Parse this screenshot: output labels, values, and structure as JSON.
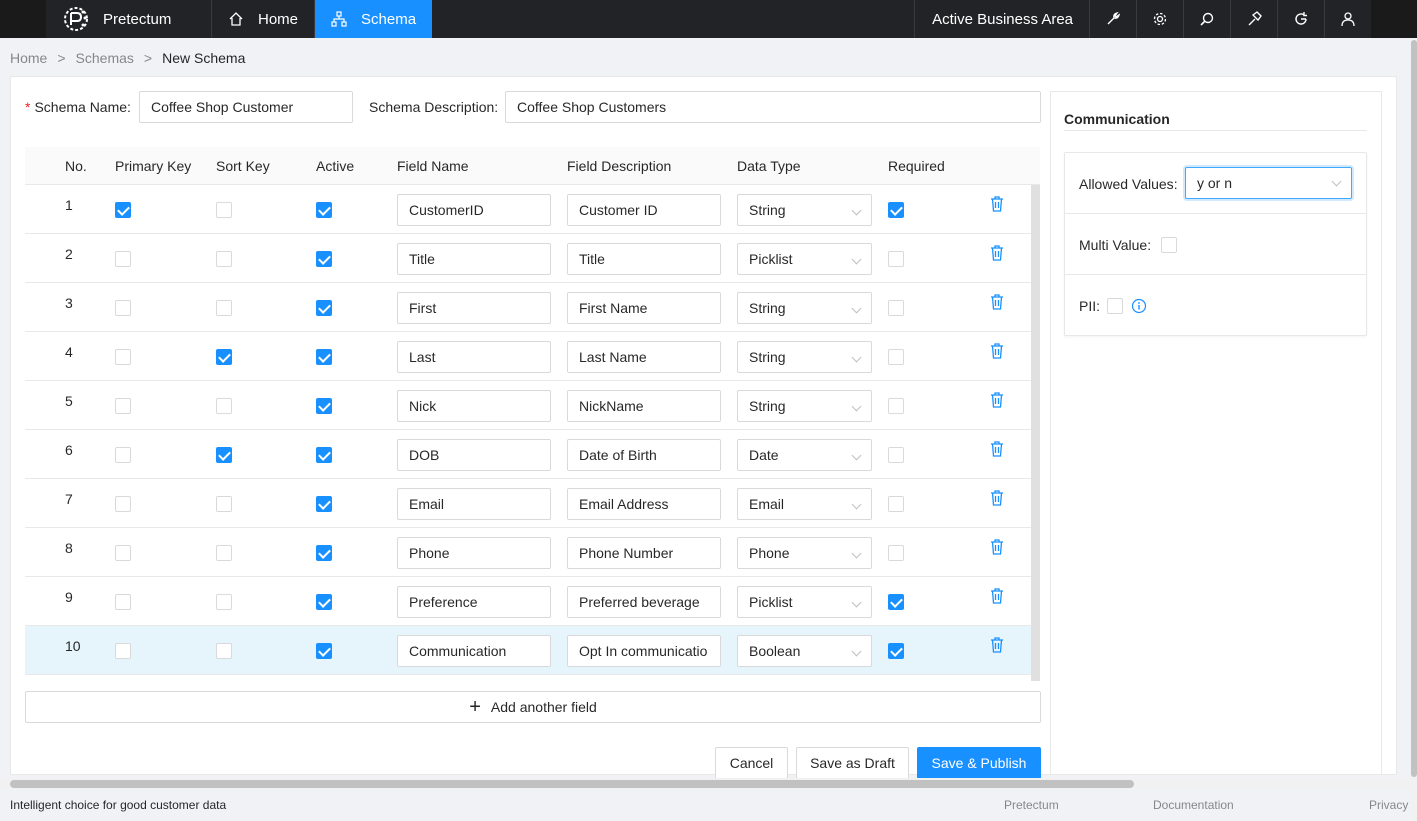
{
  "app": {
    "brand": "Pretectum"
  },
  "nav": {
    "items": [
      {
        "label": "Home",
        "icon": "home-icon"
      },
      {
        "label": "Schema",
        "icon": "schema-icon"
      }
    ],
    "area_label": "Active Business Area",
    "tool_icons": [
      "wrench-icon",
      "gear-icon",
      "search-icon",
      "hammer-icon",
      "refresh-icon",
      "user-icon"
    ]
  },
  "breadcrumb": {
    "home": "Home",
    "schemas": "Schemas",
    "current": "New Schema",
    "separator": ">"
  },
  "form": {
    "schema_name_label": "Schema Name",
    "schema_name_value": "Coffee Shop Customer",
    "schema_description_label": "Schema Description",
    "schema_description_value": "Coffee Shop Customers",
    "required_mark": "*",
    "colon": ":"
  },
  "table": {
    "columns": [
      "No.",
      "Primary Key",
      "Sort Key",
      "Active",
      "Field Name",
      "Field Description",
      "Data Type",
      "Required"
    ],
    "rows": [
      {
        "no": "1",
        "primary_key": true,
        "sort_key": false,
        "active": true,
        "field_name": "CustomerID",
        "field_description": "Customer ID",
        "data_type": "String",
        "required": true
      },
      {
        "no": "2",
        "primary_key": false,
        "sort_key": false,
        "active": true,
        "field_name": "Title",
        "field_description": "Title",
        "data_type": "Picklist",
        "required": false
      },
      {
        "no": "3",
        "primary_key": false,
        "sort_key": false,
        "active": true,
        "field_name": "First",
        "field_description": "First Name",
        "data_type": "String",
        "required": false
      },
      {
        "no": "4",
        "primary_key": false,
        "sort_key": true,
        "active": true,
        "field_name": "Last",
        "field_description": "Last Name",
        "data_type": "String",
        "required": false
      },
      {
        "no": "5",
        "primary_key": false,
        "sort_key": false,
        "active": true,
        "field_name": "Nick",
        "field_description": "NickName",
        "data_type": "String",
        "required": false
      },
      {
        "no": "6",
        "primary_key": false,
        "sort_key": true,
        "active": true,
        "field_name": "DOB",
        "field_description": "Date of Birth",
        "data_type": "Date",
        "required": false
      },
      {
        "no": "7",
        "primary_key": false,
        "sort_key": false,
        "active": true,
        "field_name": "Email",
        "field_description": "Email Address",
        "data_type": "Email",
        "required": false
      },
      {
        "no": "8",
        "primary_key": false,
        "sort_key": false,
        "active": true,
        "field_name": "Phone",
        "field_description": "Phone Number",
        "data_type": "Phone",
        "required": false
      },
      {
        "no": "9",
        "primary_key": false,
        "sort_key": false,
        "active": true,
        "field_name": "Preference",
        "field_description": "Preferred beverage",
        "data_type": "Picklist",
        "required": true
      },
      {
        "no": "10",
        "primary_key": false,
        "sort_key": false,
        "active": true,
        "field_name": "Communication",
        "field_description": "Opt In communicatio",
        "data_type": "Boolean",
        "required": true,
        "selected": true
      }
    ],
    "add_field_label": "Add another field"
  },
  "actions": {
    "cancel": "Cancel",
    "save_draft": "Save as Draft",
    "save_publish": "Save & Publish"
  },
  "panel": {
    "title": "Communication",
    "allowed_values_label": "Allowed Values",
    "allowed_values_value": "y or n",
    "multi_value_label": "Multi Value",
    "multi_value_checked": false,
    "pii_label": "PII",
    "pii_checked": false,
    "colon": ":"
  },
  "footer": {
    "tagline": "Intelligent choice for good customer data",
    "links": [
      "Pretectum",
      "Documentation",
      "Privacy"
    ]
  },
  "colors": {
    "accent": "#1890ff",
    "topbar": "#222326",
    "danger": "#f5222d"
  }
}
